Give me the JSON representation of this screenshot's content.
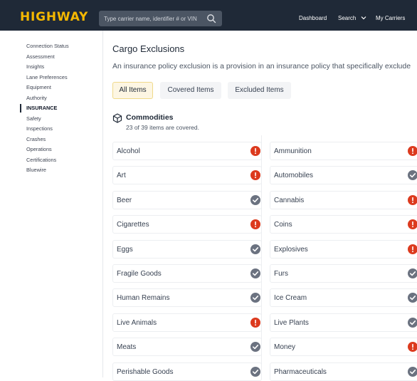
{
  "header": {
    "logo": "HIGHWAY",
    "search_placeholder": "Type carrier name, identifier # or VIN",
    "nav": {
      "dashboard": "Dashboard",
      "search": "Search",
      "my_carriers": "My Carriers"
    }
  },
  "sidebar": {
    "items": [
      {
        "label": "Connection Status",
        "active": false
      },
      {
        "label": "Assessment",
        "active": false
      },
      {
        "label": "Insights",
        "active": false
      },
      {
        "label": "Lane Preferences",
        "active": false
      },
      {
        "label": "Equipment",
        "active": false
      },
      {
        "label": "Authority",
        "active": false
      },
      {
        "label": "INSURANCE",
        "active": true
      },
      {
        "label": "Safety",
        "active": false
      },
      {
        "label": "Inspections",
        "active": false
      },
      {
        "label": "Crashes",
        "active": false
      },
      {
        "label": "Operations",
        "active": false
      },
      {
        "label": "Certifications",
        "active": false
      },
      {
        "label": "Bluewire",
        "active": false
      }
    ]
  },
  "main": {
    "title": "Cargo Exclusions",
    "description": "An insurance policy exclusion is a provision in an insurance policy that specifically exclude",
    "tabs": [
      {
        "label": "All Items",
        "active": true
      },
      {
        "label": "Covered Items",
        "active": false
      },
      {
        "label": "Excluded Items",
        "active": false
      }
    ],
    "section": {
      "title": "Commodities",
      "subtitle": "23 of 39 items are covered."
    },
    "items": [
      {
        "label": "Alcohol",
        "status": "excluded"
      },
      {
        "label": "Ammunition",
        "status": "excluded"
      },
      {
        "label": "Art",
        "status": "excluded"
      },
      {
        "label": "Automobiles",
        "status": "covered"
      },
      {
        "label": "Beer",
        "status": "covered"
      },
      {
        "label": "Cannabis",
        "status": "excluded"
      },
      {
        "label": "Cigarettes",
        "status": "excluded"
      },
      {
        "label": "Coins",
        "status": "excluded"
      },
      {
        "label": "Eggs",
        "status": "covered"
      },
      {
        "label": "Explosives",
        "status": "excluded"
      },
      {
        "label": "Fragile Goods",
        "status": "covered"
      },
      {
        "label": "Furs",
        "status": "covered"
      },
      {
        "label": "Human Remains",
        "status": "covered"
      },
      {
        "label": "Ice Cream",
        "status": "covered"
      },
      {
        "label": "Live Animals",
        "status": "excluded"
      },
      {
        "label": "Live Plants",
        "status": "covered"
      },
      {
        "label": "Meats",
        "status": "covered"
      },
      {
        "label": "Money",
        "status": "excluded"
      },
      {
        "label": "Perishable Goods",
        "status": "covered"
      },
      {
        "label": "Pharmaceuticals",
        "status": "covered"
      }
    ]
  },
  "colors": {
    "brand": "#f5b800",
    "header_bg": "#1f2937",
    "excluded": "#dc3a1e",
    "covered": "#6b7280"
  }
}
